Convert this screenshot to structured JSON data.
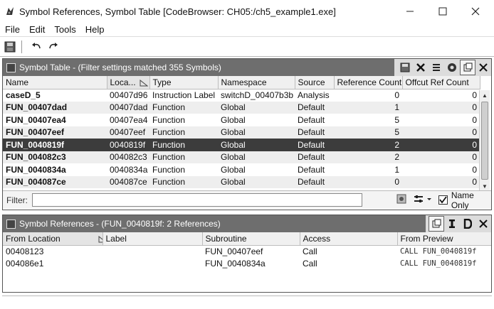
{
  "window": {
    "title": "Symbol References, Symbol Table [CodeBrowser: CH05:/ch5_example1.exe]",
    "controls": {
      "minimize": "—",
      "maximize": "☐",
      "close": "✕"
    }
  },
  "menu": {
    "items": [
      "File",
      "Edit",
      "Tools",
      "Help"
    ]
  },
  "toolbar": {
    "icons": [
      "save-icon",
      "undo-icon",
      "redo-icon"
    ]
  },
  "symbol_table": {
    "title": "Symbol Table - (Filter settings matched 355 Symbols)",
    "columns": [
      "Name",
      "Loca...",
      "Type",
      "Namespace",
      "Source",
      "Reference Count",
      "Offcut Ref Count"
    ],
    "rows": [
      [
        "caseD_5",
        "00407d96",
        "Instruction Label",
        "switchD_00407b3b",
        "Analysis",
        "0",
        "0"
      ],
      [
        "FUN_00407dad",
        "00407dad",
        "Function",
        "Global",
        "Default",
        "1",
        "0"
      ],
      [
        "FUN_00407ea4",
        "00407ea4",
        "Function",
        "Global",
        "Default",
        "5",
        "0"
      ],
      [
        "FUN_00407eef",
        "00407eef",
        "Function",
        "Global",
        "Default",
        "5",
        "0"
      ],
      [
        "FUN_0040819f",
        "0040819f",
        "Function",
        "Global",
        "Default",
        "2",
        "0"
      ],
      [
        "FUN_004082c3",
        "004082c3",
        "Function",
        "Global",
        "Default",
        "2",
        "0"
      ],
      [
        "FUN_0040834a",
        "0040834a",
        "Function",
        "Global",
        "Default",
        "1",
        "0"
      ],
      [
        "FUN_004087ce",
        "004087ce",
        "Function",
        "Global",
        "Default",
        "0",
        "0"
      ]
    ],
    "selected_row": 4,
    "filter_label": "Filter:",
    "filter_value": "",
    "name_only_label": "Name Only",
    "name_only_checked": true
  },
  "symbol_refs": {
    "title": "Symbol References - (FUN_0040819f: 2 References)",
    "columns": [
      "From Location",
      "Label",
      "Subroutine",
      "Access",
      "From Preview"
    ],
    "rows": [
      [
        "00408123",
        "",
        "FUN_00407eef",
        "Call",
        "CALL FUN_0040819f"
      ],
      [
        "004086e1",
        "",
        "FUN_0040834a",
        "Call",
        "CALL FUN_0040819f"
      ]
    ]
  }
}
